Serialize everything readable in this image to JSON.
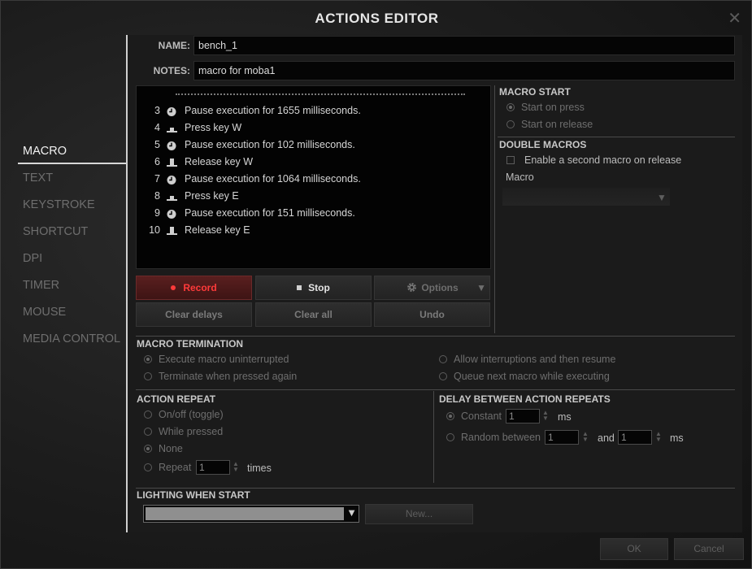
{
  "window": {
    "title": "ACTIONS EDITOR",
    "close_glyph": "✕"
  },
  "sidebar": {
    "items": [
      {
        "label": "MACRO",
        "active": true
      },
      {
        "label": "TEXT"
      },
      {
        "label": "KEYSTROKE"
      },
      {
        "label": "SHORTCUT"
      },
      {
        "label": "DPI"
      },
      {
        "label": "TIMER"
      },
      {
        "label": "MOUSE"
      },
      {
        "label": "MEDIA CONTROL"
      }
    ]
  },
  "form": {
    "name_label": "NAME:",
    "name_value": "bench_1",
    "notes_label": "NOTES:",
    "notes_value": "macro for moba1"
  },
  "macro_steps": [
    {
      "num": "3",
      "icon": "clock-icon",
      "text": "Pause execution for 1655 milliseconds."
    },
    {
      "num": "4",
      "icon": "key-press-icon",
      "text": "Press key W"
    },
    {
      "num": "5",
      "icon": "clock-icon",
      "text": "Pause execution for 102 milliseconds."
    },
    {
      "num": "6",
      "icon": "key-release-icon",
      "text": "Release key W"
    },
    {
      "num": "7",
      "icon": "clock-icon",
      "text": "Pause execution for 1064 milliseconds."
    },
    {
      "num": "8",
      "icon": "key-press-icon",
      "text": "Press key E"
    },
    {
      "num": "9",
      "icon": "clock-icon",
      "text": "Pause execution for 151 milliseconds."
    },
    {
      "num": "10",
      "icon": "key-release-icon",
      "text": "Release key E"
    }
  ],
  "buttons": {
    "record": "Record",
    "stop": "Stop",
    "options": "Options",
    "clear_delays": "Clear delays",
    "clear_all": "Clear all",
    "undo": "Undo",
    "new": "New...",
    "ok": "OK",
    "cancel": "Cancel"
  },
  "macro_start": {
    "title": "MACRO START",
    "start_on_press": "Start on press",
    "start_on_release": "Start on release"
  },
  "double_macros": {
    "title": "DOUBLE MACROS",
    "enable_label": "Enable a second macro on release",
    "macro_label": "Macro"
  },
  "termination": {
    "title": "MACRO TERMINATION",
    "opt1": "Execute macro uninterrupted",
    "opt2": "Terminate when pressed again",
    "opt3": "Allow interruptions and then resume",
    "opt4": "Queue next macro while executing"
  },
  "action_repeat": {
    "title": "ACTION REPEAT",
    "toggle": "On/off (toggle)",
    "while_pressed": "While pressed",
    "none": "None",
    "repeat": "Repeat",
    "repeat_value": "1",
    "times": "times"
  },
  "delay_repeats": {
    "title": "DELAY BETWEEN ACTION REPEATS",
    "constant": "Constant",
    "constant_value": "1",
    "ms": "ms",
    "random": "Random between",
    "random_min": "1",
    "and": "and",
    "random_max": "1"
  },
  "lighting": {
    "title": "LIGHTING WHEN START"
  }
}
